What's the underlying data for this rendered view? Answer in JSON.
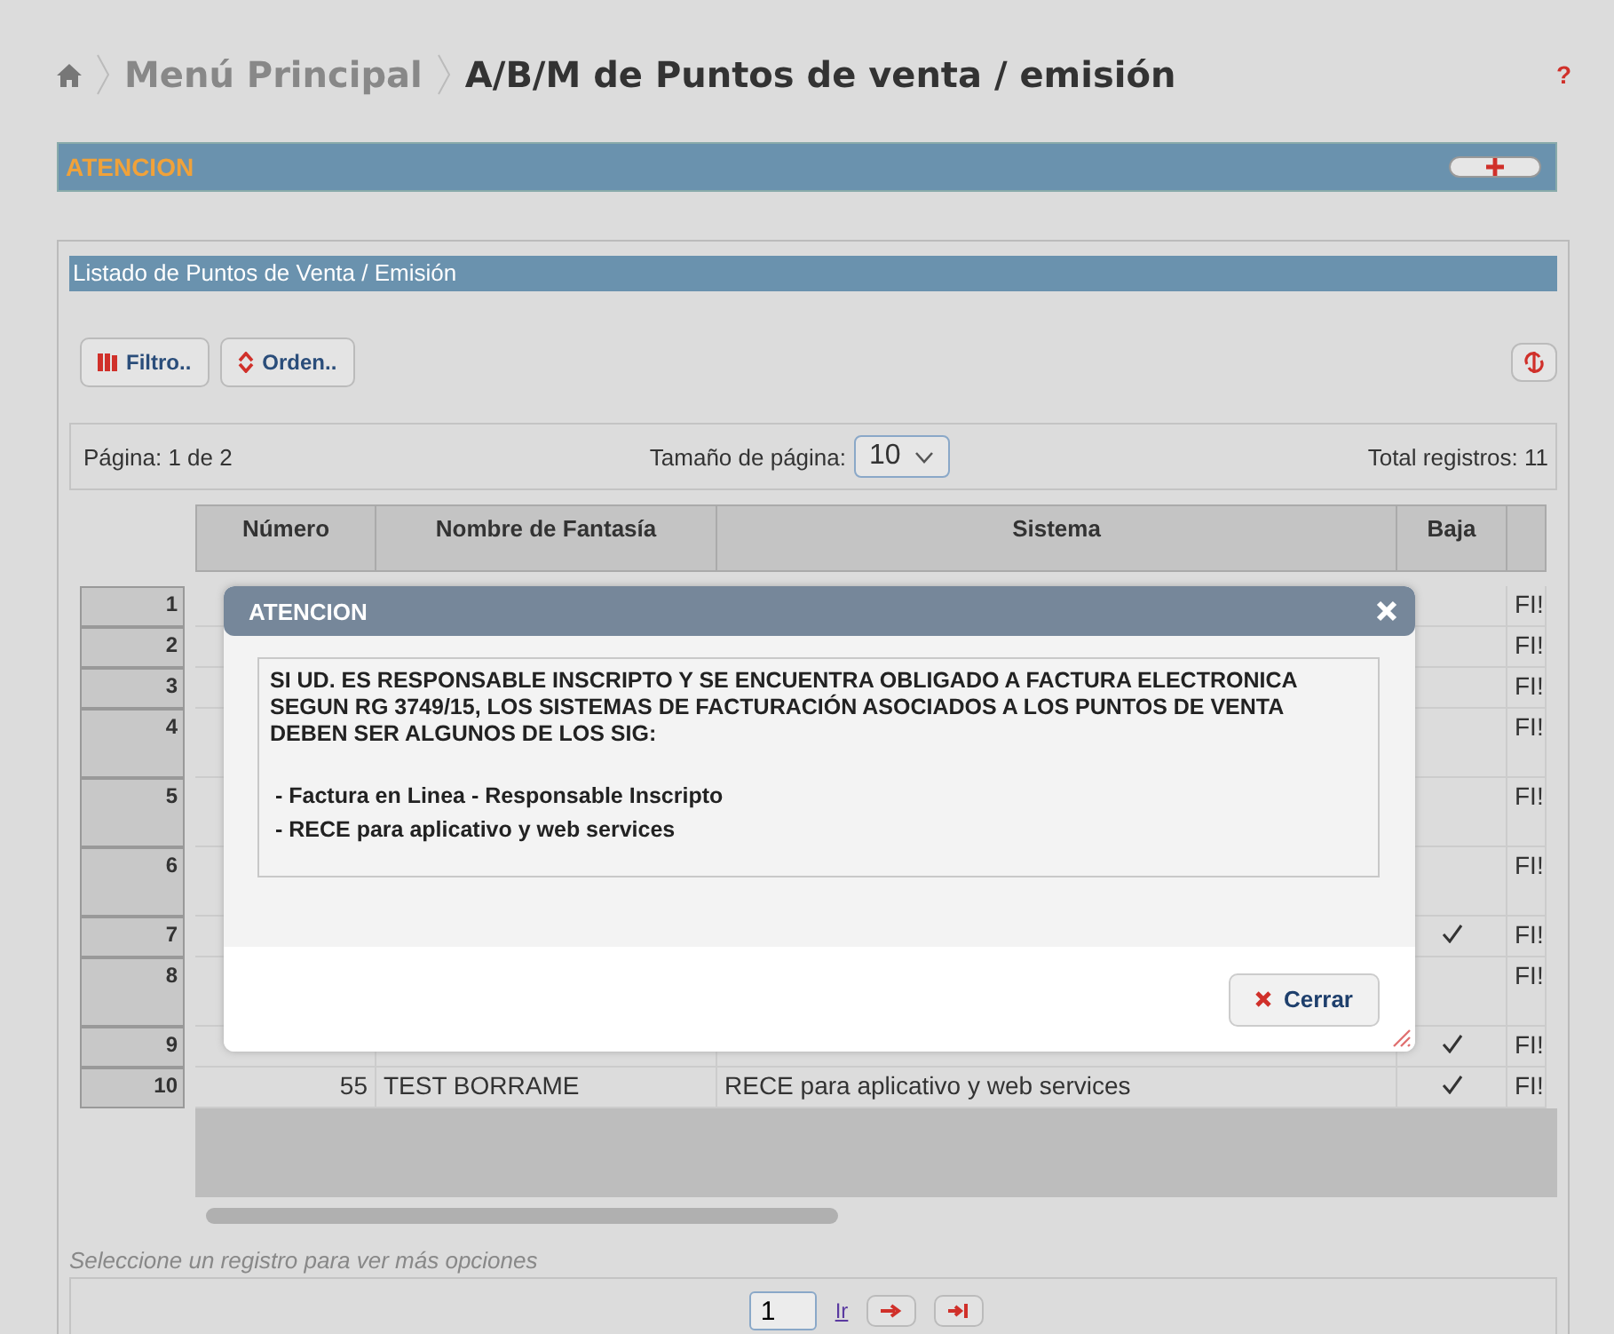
{
  "breadcrumb": {
    "items": [
      "Menú Principal",
      "A/B/M de Puntos de venta / emisión"
    ]
  },
  "help": "?",
  "notice_bar": {
    "title": "ATENCION"
  },
  "panel": {
    "title": "Listado de Puntos de Venta / Emisión",
    "toolbar": [
      {
        "label": "Filtro..",
        "kind": "filter"
      },
      {
        "label": "Orden..",
        "kind": "sort"
      }
    ],
    "pager_info": {
      "page": "Página: 1 de 2",
      "page_size_label": "Tamaño de página:",
      "page_size": "10",
      "total": "Total registros: 11"
    },
    "table": {
      "columns": [
        "Número",
        "Nombre de Fantasía",
        "Sistema",
        "Baja"
      ],
      "rows": [
        {
          "index": "1",
          "tall": false,
          "baja": false,
          "column_5": "FI!"
        },
        {
          "index": "2",
          "tall": false,
          "baja": false,
          "column_5": "FI!"
        },
        {
          "index": "3",
          "tall": false,
          "baja": false,
          "column_5": "FI!"
        },
        {
          "index": "4",
          "tall": true,
          "baja": false,
          "column_5": "FI!"
        },
        {
          "index": "5",
          "tall": true,
          "baja": false,
          "column_5": "FI!"
        },
        {
          "index": "6",
          "tall": true,
          "baja": false,
          "column_5": "FI!"
        },
        {
          "index": "7",
          "tall": false,
          "baja": true,
          "column_5": "FI!"
        },
        {
          "index": "8",
          "tall": true,
          "baja": false,
          "column_5": "FI!"
        },
        {
          "index": "9",
          "tall": false,
          "baja": true,
          "column_5": "FI!"
        },
        {
          "index": "10",
          "tall": false,
          "baja": true,
          "numero": "55",
          "nombre": "TEST BORRAME",
          "sistema": "RECE para aplicativo y web services",
          "column_5": "FI!"
        }
      ]
    },
    "hint": "Seleccione un registro para ver más opciones",
    "goto": {
      "value": "1",
      "link": "Ir"
    }
  },
  "dialog": {
    "title": "ATENCION",
    "message": "SI UD. ES RESPONSABLE INSCRIPTO Y SE ENCUENTRA OBLIGADO A FACTURA ELECTRONICA SEGUN RG 3749/15, LOS SISTEMAS DE FACTURACIÓN ASOCIADOS A LOS PUNTOS DE VENTA DEBEN SER ALGUNOS DE LOS SIG:",
    "options": [
      "- Factura en Linea - Responsable Inscripto",
      "- RECE para aplicativo y web services"
    ],
    "button": "Cerrar"
  }
}
